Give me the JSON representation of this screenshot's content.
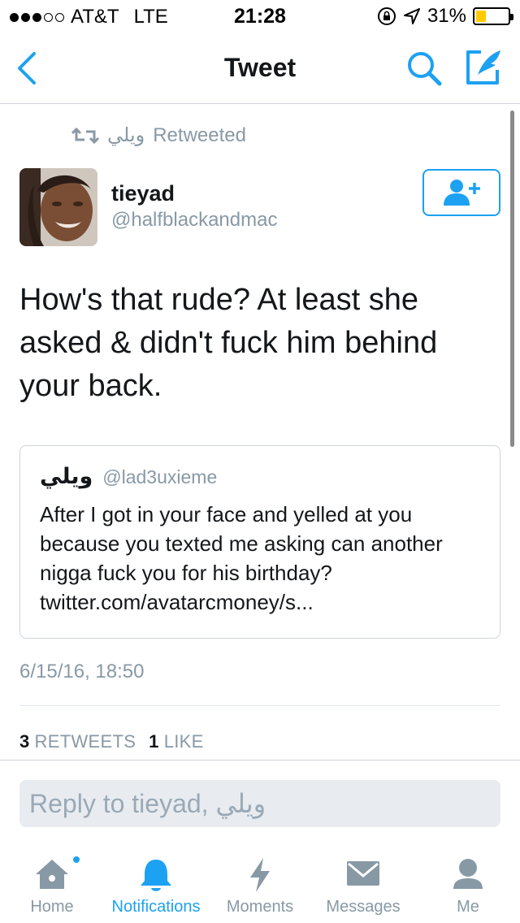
{
  "status_bar": {
    "carrier": "AT&T",
    "network": "LTE",
    "time": "21:28",
    "battery": "31%",
    "battery_level": 0.31,
    "battery_color": "#ffcc00"
  },
  "nav": {
    "title": "Tweet"
  },
  "retweet_context": {
    "retweeter": "ويلي",
    "label": "Retweeted"
  },
  "tweet": {
    "author_name": "tieyad",
    "author_handle": "@halfblackandmac",
    "text": "How's that rude? At least she asked & didn't fuck him behind your back.",
    "timestamp": "6/15/16, 18:50"
  },
  "quoted_tweet": {
    "author_name": "ويلي",
    "author_handle": "@lad3uxieme",
    "text": "After I got in your face and yelled at you because you texted me asking can another nigga fuck you for his birthday? twitter.com/avatarcmoney/s..."
  },
  "stats": {
    "retweets_count": "3",
    "retweets_label": "RETWEETS",
    "likes_count": "1",
    "likes_label": "LIKE"
  },
  "reply": {
    "placeholder": "Reply to tieyad, ويلي"
  },
  "tabs": [
    {
      "label": "Home",
      "icon": "home-icon",
      "has_badge": true
    },
    {
      "label": "Notifications",
      "icon": "bell-icon",
      "active": true
    },
    {
      "label": "Moments",
      "icon": "lightning-icon"
    },
    {
      "label": "Messages",
      "icon": "envelope-icon"
    },
    {
      "label": "Me",
      "icon": "person-icon"
    }
  ],
  "colors": {
    "accent": "#1da1f2",
    "secondary_text": "#8899a6",
    "primary_text": "#14171a"
  }
}
